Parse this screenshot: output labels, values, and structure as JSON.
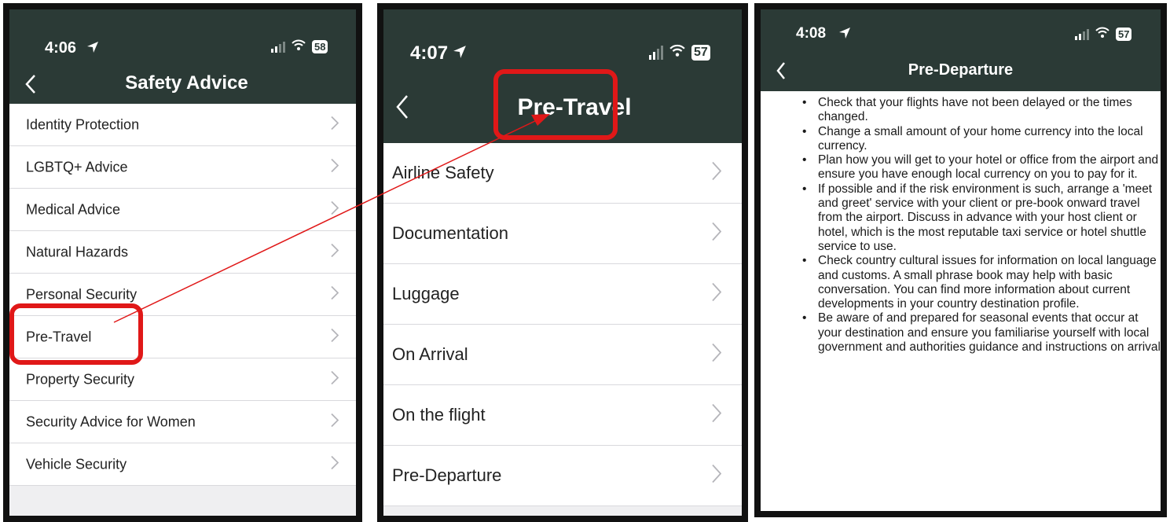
{
  "colors": {
    "header": "#2b3a36",
    "highlight": "#e01818",
    "arrow": "#e01818"
  },
  "panel1": {
    "time": "4:06",
    "battery": "58",
    "title": "Safety Advice",
    "items": [
      "Identity Protection",
      "LGBTQ+ Advice",
      "Medical Advice",
      "Natural Hazards",
      "Personal Security",
      "Pre-Travel",
      "Property Security",
      "Security Advice for Women",
      "Vehicle Security"
    ]
  },
  "panel2": {
    "time": "4:07",
    "battery": "57",
    "title": "Pre-Travel",
    "items": [
      "Airline Safety",
      "Documentation",
      "Luggage",
      "On Arrival",
      "On the flight",
      "Pre-Departure"
    ]
  },
  "panel3": {
    "time": "4:08",
    "battery": "57",
    "title": "Pre-Departure",
    "bullets": [
      "Check that your flights have not been delayed or the times changed.",
      "Change a small amount of your home currency into the local currency.",
      "Plan how you will get to your hotel or office from the airport and ensure you have enough local currency on you to pay for it.",
      "If possible and if the risk environment is such, arrange a 'meet and greet' service with your client or pre-book onward travel from the airport. Discuss in advance with your host client or hotel, which is the most reputable taxi service or hotel shuttle service to use.",
      "Check country cultural issues for information on local language and customs. A small phrase book may help with basic conversation. You can find more information about current developments in your country destination profile.",
      "Be aware of and prepared for seasonal events that occur at your destination and ensure you familiarise yourself with local government and authorities guidance and instructions on arrival"
    ]
  }
}
